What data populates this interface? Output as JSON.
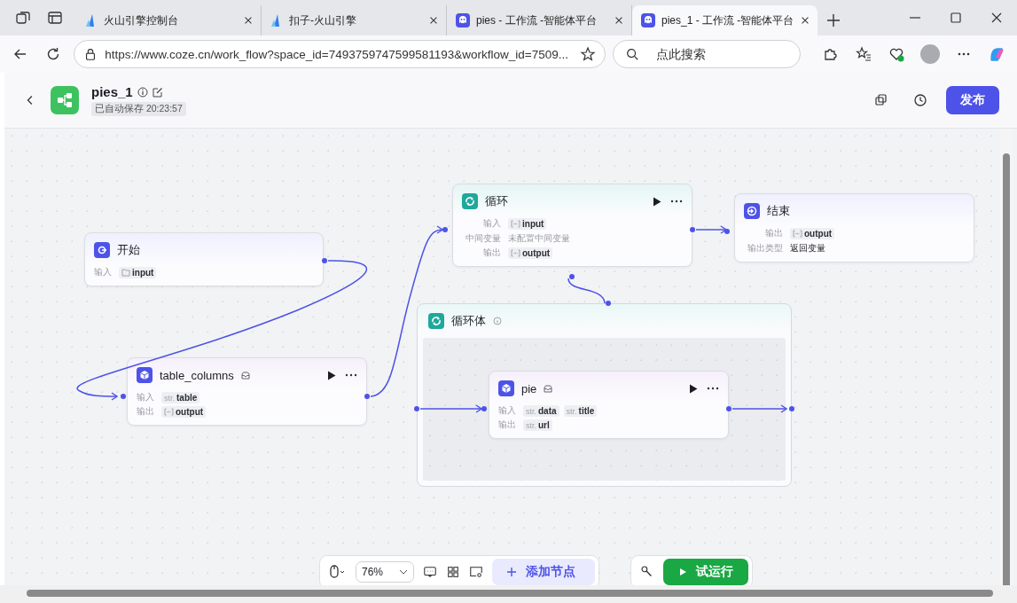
{
  "browser": {
    "tabs": [
      {
        "title": "火山引擎控制台",
        "kind": "volcano",
        "selected": false
      },
      {
        "title": "扣子-火山引擎",
        "kind": "volcano",
        "selected": false
      },
      {
        "title": "pies - 工作流 -智能体平台",
        "kind": "coze",
        "selected": false
      },
      {
        "title": "pies_1 - 工作流 -智能体平台",
        "kind": "coze",
        "selected": true
      }
    ],
    "url": "https://www.coze.cn/work_flow?space_id=7493759747599581193&workflow_id=7509...",
    "search": {
      "placeholder": "点此搜索"
    }
  },
  "header": {
    "title": "pies_1",
    "saved": "已自动保存 20:23:57",
    "publish": "发布"
  },
  "nodes": [
    {
      "kind": "start",
      "title": "开始",
      "rows": [
        {
          "label": "输入",
          "params": [
            {
              "kind": "object",
              "name": "input"
            }
          ]
        }
      ]
    },
    {
      "kind": "plugin",
      "title": "table_columns",
      "rows": [
        {
          "label": "输入",
          "params": [
            {
              "kind": "string",
              "type_label": "str.",
              "name": "table"
            }
          ]
        },
        {
          "label": "输出",
          "params": [
            {
              "kind": "array",
              "name": "output"
            }
          ]
        }
      ]
    },
    {
      "kind": "loop",
      "title": "循环",
      "rows": [
        {
          "label": "输入",
          "params": [
            {
              "kind": "array",
              "name": "input"
            }
          ]
        },
        {
          "label": "中间变量",
          "value": "未配置中间变量",
          "muted": true
        },
        {
          "label": "输出",
          "params": [
            {
              "kind": "array",
              "name": "output"
            }
          ]
        }
      ]
    },
    {
      "kind": "end",
      "title": "结束",
      "rows": [
        {
          "label": "输出",
          "params": [
            {
              "kind": "array",
              "name": "output"
            }
          ]
        },
        {
          "label": "输出类型",
          "value": "返回变量",
          "muted": false
        }
      ]
    }
  ],
  "loop_body": {
    "title": "循环体",
    "nodes": [
      {
        "kind": "plugin",
        "title": "pie",
        "rows": [
          {
            "label": "输入",
            "params": [
              {
                "kind": "string",
                "type_label": "str.",
                "name": "data"
              },
              {
                "kind": "string",
                "type_label": "str.",
                "name": "title"
              }
            ]
          },
          {
            "label": "输出",
            "params": [
              {
                "kind": "string",
                "type_label": "str.",
                "name": "url"
              }
            ]
          }
        ]
      }
    ]
  },
  "toolbar": {
    "zoom": "76%",
    "add_node": "添加节点",
    "test_run": "试运行"
  }
}
